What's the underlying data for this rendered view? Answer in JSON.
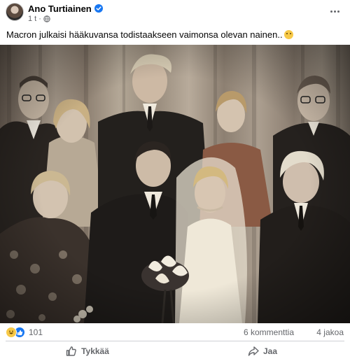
{
  "post": {
    "author": "Ano Turtiainen",
    "time": "1 t",
    "separator": "·",
    "text": "Macron julkaisi hääkuvansa todistaakseen vaimonsa olevan nainen..",
    "text_emoji": "flushed-face-emoji"
  },
  "stats": {
    "reaction_count": "101",
    "comments": "6 kommenttia",
    "shares": "4 jakoa"
  },
  "actions": {
    "like_label": "Tykkää",
    "share_label": "Jaa"
  },
  "colors": {
    "verified_blue": "#1877f2",
    "secondary_text": "#65676b",
    "divider": "#ced0d4",
    "sepia_light": "#b8ab9b",
    "sepia_dark": "#3a322b"
  },
  "icons": {
    "verified": "verified-badge-icon",
    "privacy": "globe-icon",
    "more": "more-options-icon",
    "like": "thumbs-up-icon",
    "share": "share-arrow-icon"
  }
}
